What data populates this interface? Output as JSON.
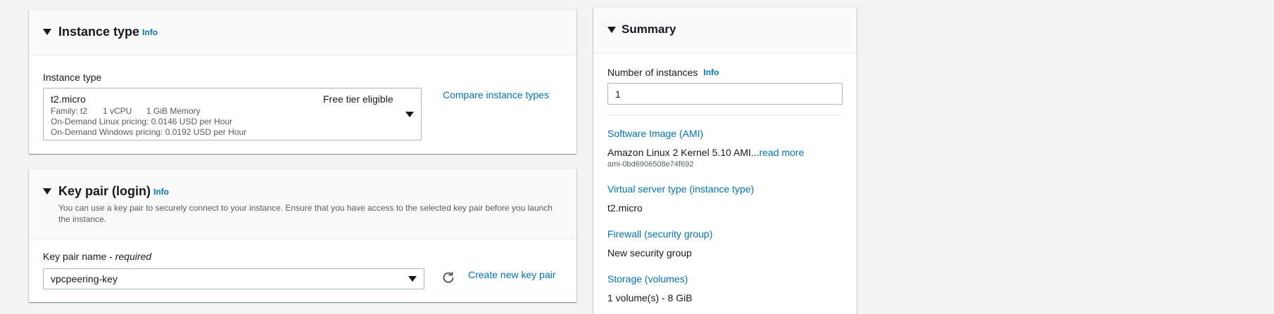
{
  "instance_type": {
    "title": "Instance type",
    "info": "Info",
    "field_label": "Instance type",
    "selected": {
      "name": "t2.micro",
      "badge": "Free tier eligible",
      "family": "Family: t2",
      "vcpu": "1 vCPU",
      "memory": "1 GiB Memory",
      "linux_pricing": "On-Demand Linux pricing: 0.0146 USD per Hour",
      "windows_pricing": "On-Demand Windows pricing: 0.0192 USD per Hour"
    },
    "compare_link": "Compare instance types"
  },
  "key_pair": {
    "title": "Key pair (login)",
    "info": "Info",
    "description_line1": "You can use a key pair to securely connect to your instance. Ensure that you have access to the selected key pair before you launch",
    "description_line2": "the instance.",
    "field_label": "Key pair name - ",
    "required": "required",
    "selected": "vpcpeering-key",
    "create_link": "Create new key pair"
  },
  "summary": {
    "title": "Summary",
    "instances_label": "Number of instances",
    "instances_info": "Info",
    "instances_value": "1",
    "ami_label": "Software Image (AMI)",
    "ami_value": "Amazon Linux 2 Kernel 5.10 AMI...",
    "ami_read_more": "read more",
    "ami_id": "ami-0bd6906508e74f692",
    "server_type_label": "Virtual server type (instance type)",
    "server_type_value": "t2.micro",
    "firewall_label": "Firewall (security group)",
    "firewall_value": "New security group",
    "storage_label": "Storage (volumes)",
    "storage_value": "1 volume(s) - 8 GiB"
  },
  "icons": {
    "collapse": "caret-down-icon",
    "dropdown": "caret-down-icon",
    "refresh": "refresh-icon"
  },
  "colors": {
    "link": "#0073bb",
    "background": "#f2f3f3",
    "text": "#16191f"
  }
}
